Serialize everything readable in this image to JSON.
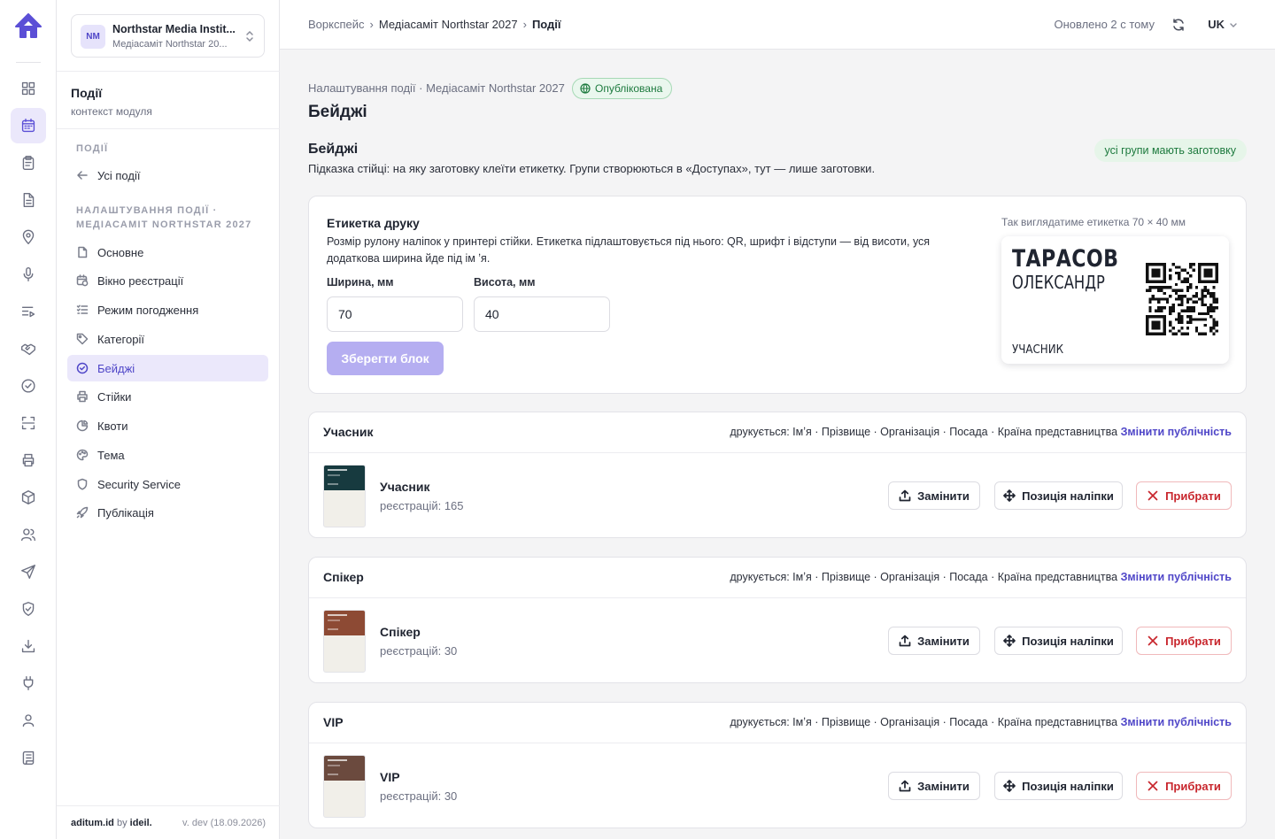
{
  "rail": {
    "items": [
      {
        "icon": "dashboard-icon"
      },
      {
        "icon": "calendar-icon",
        "active": true
      },
      {
        "icon": "clipboard-icon"
      },
      {
        "icon": "document-icon"
      },
      {
        "icon": "location-pin-icon"
      },
      {
        "icon": "microphone-icon"
      },
      {
        "icon": "list-play-icon"
      },
      {
        "icon": "handshake-icon"
      },
      {
        "icon": "check-circle-icon"
      },
      {
        "icon": "scan-icon"
      },
      {
        "icon": "printer-icon"
      },
      {
        "icon": "box-icon"
      },
      {
        "icon": "users-icon"
      },
      {
        "icon": "send-icon"
      },
      {
        "icon": "shield-check-icon"
      },
      {
        "icon": "download-icon"
      },
      {
        "icon": "plug-icon"
      },
      {
        "icon": "people-icon"
      },
      {
        "icon": "scroll-icon"
      }
    ]
  },
  "org": {
    "initials": "NM",
    "name": "Northstar Media Instit...",
    "subtitle": "Медіасаміт Northstar 20..."
  },
  "context": {
    "title": "Події",
    "subtitle": "контекст модуля"
  },
  "sidebar": {
    "section1": "ПОДІЇ",
    "all_events": "Усі події",
    "section2_line1": "НАЛАШТУВАННЯ ПОДІЇ ·",
    "section2_line2": "МЕДІАСАМІТ NORTHSTAR 2027",
    "items": [
      {
        "label": "Основне",
        "icon": "file-icon"
      },
      {
        "label": "Вікно реєстрації",
        "icon": "calendar-clock-icon"
      },
      {
        "label": "Режим погодження",
        "icon": "list-check-icon"
      },
      {
        "label": "Категорії",
        "icon": "tag-icon"
      },
      {
        "label": "Бейджі",
        "icon": "badge-check-icon",
        "active": true
      },
      {
        "label": "Стійки",
        "icon": "printer-icon"
      },
      {
        "label": "Квоти",
        "icon": "pie-chart-icon"
      },
      {
        "label": "Тема",
        "icon": "palette-icon"
      },
      {
        "label": "Security Service",
        "icon": "shield-icon"
      },
      {
        "label": "Публікація",
        "icon": "rocket-icon"
      }
    ]
  },
  "footer": {
    "brand": "aditum.id",
    "by": "by",
    "maker": "ideil.",
    "version": "v. dev (18.09.2026)"
  },
  "topbar": {
    "crumb1": "Воркспейс",
    "crumb2": "Медіасаміт Northstar 2027",
    "crumb3": "Події",
    "sep": "›",
    "updated": "Оновлено 2 с тому",
    "lang": "UK"
  },
  "page": {
    "subtitle": "Налаштування події · Медіасаміт Northstar 2027",
    "status": "Опублікована",
    "title": "Бейджі",
    "section_title": "Бейджі",
    "section_desc": "Підказка стійці: на яку заготовку клеїти етикетку. Групи створюються в «Доступах», тут — лише заготовки.",
    "section_badge": "усі групи мають заготовку"
  },
  "print": {
    "title": "Етикетка друку",
    "desc": "Розмір рулону наліпок у принтері стійки. Етикетка підлаштовується під нього: QR, шрифт і відступи — від висоти, уся додаткова ширина йде під ім ʼя.",
    "width_label": "Ширина, мм",
    "width_value": "70",
    "height_label": "Висота, мм",
    "height_value": "40",
    "save": "Зберегти блок",
    "preview_caption": "Так виглядатиме етикетка 70 × 40 мм",
    "preview_lastname": "ТАРАСОВ",
    "preview_firstname": "ОЛЕКСАНДР",
    "preview_role": "УЧАСНИК"
  },
  "groups": [
    {
      "title": "Учасник",
      "prints": "друкується: Імʼя · Прізвище · Організація · Посада · Країна представництва",
      "change": "Змінити публічність",
      "name": "Учасник",
      "count": "реєстрацій: 165",
      "color": "#173a3f",
      "replace": "Замінити",
      "position": "Позиція наліпки",
      "remove": "Прибрати"
    },
    {
      "title": "Спікер",
      "prints": "друкується: Імʼя · Прізвище · Організація · Посада · Країна представництва",
      "change": "Змінити публічність",
      "name": "Спікер",
      "count": "реєстрацій: 30",
      "color": "#8d4a34",
      "replace": "Замінити",
      "position": "Позиція наліпки",
      "remove": "Прибрати"
    },
    {
      "title": "VIP",
      "prints": "друкується: Імʼя · Прізвище · Організація · Посада · Країна представництва",
      "change": "Змінити публічність",
      "name": "VIP",
      "count": "реєстрацій: 30",
      "color": "#6b4a3e",
      "replace": "Замінити",
      "position": "Позиція наліпки",
      "remove": "Прибрати"
    }
  ]
}
